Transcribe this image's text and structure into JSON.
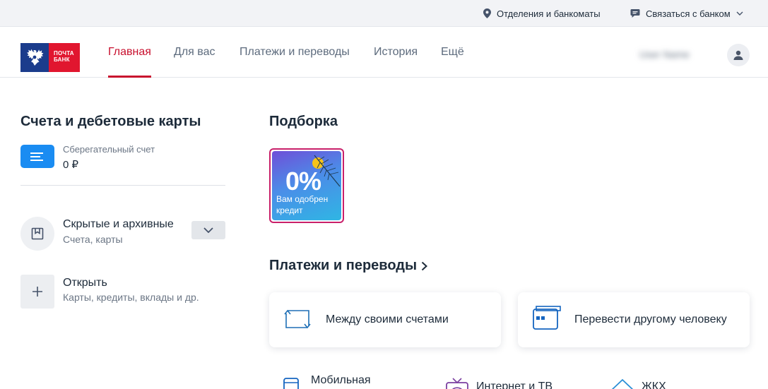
{
  "topbar": {
    "branches_label": "Отделения и банкоматы",
    "contact_label": "Связаться с банком"
  },
  "logo": {
    "line1": "ПОЧТА",
    "line2": "БАНК"
  },
  "nav": {
    "items": [
      {
        "label": "Главная",
        "active": true
      },
      {
        "label": "Для вас"
      },
      {
        "label": "Платежи и переводы"
      },
      {
        "label": "История"
      },
      {
        "label": "Ещё"
      }
    ],
    "user_name": "User Name"
  },
  "accounts": {
    "title": "Счета и дебетовые карты",
    "items": [
      {
        "name": "Сберегательный счет",
        "balance": "0 ₽"
      }
    ],
    "hidden": {
      "title": "Скрытые и архивные",
      "subtitle": "Счета, карты"
    },
    "open": {
      "title": "Открыть",
      "subtitle": "Карты, кредиты, вклады и др."
    }
  },
  "picks": {
    "title": "Подборка",
    "story": {
      "headline": "0%",
      "caption": "Вам одобрен кредит"
    }
  },
  "payments": {
    "title": "Платежи и переводы",
    "cards": [
      {
        "label": "Между своими счетами"
      },
      {
        "label": "Перевести другому человеку"
      }
    ],
    "quick": [
      {
        "label": "Мобильная"
      },
      {
        "label": "Интернет и ТВ"
      },
      {
        "label": "ЖКХ"
      }
    ]
  },
  "colors": {
    "accent_red": "#c8102e",
    "brand_blue": "#1b3c8c",
    "account_icon_blue": "#1a8cf2",
    "payment_icon_blue": "#1565c0"
  }
}
